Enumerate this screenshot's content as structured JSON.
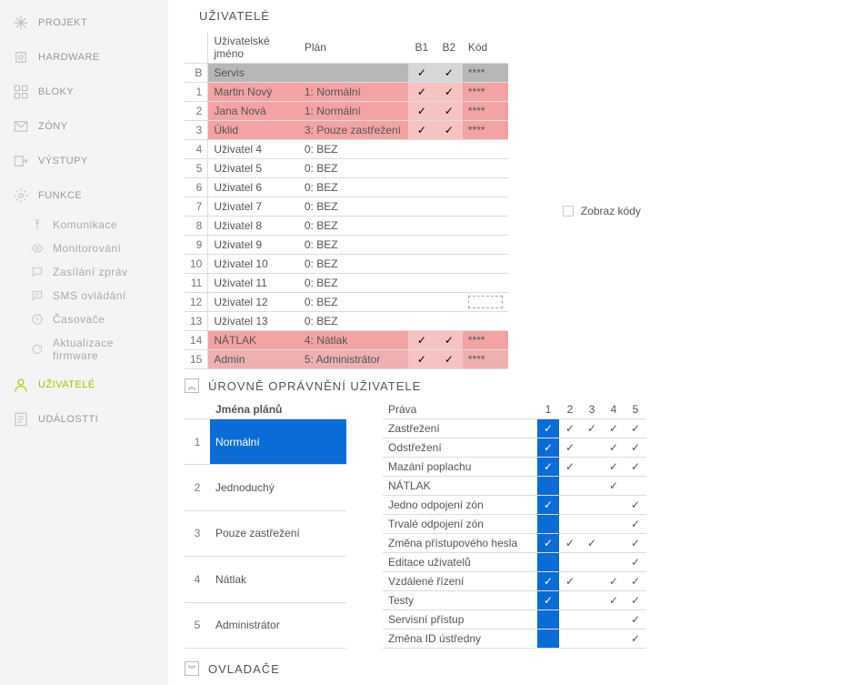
{
  "sidebar": {
    "projekt": "PROJEKT",
    "hardware": "HARDWARE",
    "bloky": "BLOKY",
    "zony": "ZÓNY",
    "vystupy": "VÝSTUPY",
    "funkce": "FUNKCE",
    "komunikace": "Komunikace",
    "monitorovani": "Monitorování",
    "zasilani": "Zasílání zpráv",
    "sms": "SMS ovládání",
    "casovace": "Časovače",
    "aktualizace": "Aktualizace firmware",
    "uzivatele": "UŽIVATELÉ",
    "udalosti": "UDÁLOSTTI"
  },
  "headings": {
    "users": "UŽIVATELÉ",
    "levels": "ÚROVNĚ OPRÁVNĚNÍ UŽIVATELE",
    "controllers": "OVLADAČE"
  },
  "showcodes_label": "Zobraz kódy",
  "users_table": {
    "h_num": "",
    "h_name": "Uživatelské jméno",
    "h_plan": "Plán",
    "h_b1": "B1",
    "h_b2": "B2",
    "h_kod": "Kód",
    "rows": [
      {
        "n": "B",
        "name": "Servis",
        "plan": "",
        "b1": "✓",
        "b2": "✓",
        "kod": "****",
        "cls": "greyrow"
      },
      {
        "n": "1",
        "name": "Martin Nový",
        "plan": "1: Normální",
        "b1": "✓",
        "b2": "✓",
        "kod": "****",
        "cls": "pinkrow"
      },
      {
        "n": "2",
        "name": "Jana Nová",
        "plan": "1: Normální",
        "b1": "✓",
        "b2": "✓",
        "kod": "****",
        "cls": "pinkrow"
      },
      {
        "n": "3",
        "name": "Úklid",
        "plan": "3: Pouze zastřežení",
        "b1": "✓",
        "b2": "✓",
        "kod": "****",
        "cls": "pinkrow"
      },
      {
        "n": "4",
        "name": "Uživatel  4",
        "plan": "0: BEZ",
        "b1": "",
        "b2": "",
        "kod": "",
        "cls": ""
      },
      {
        "n": "5",
        "name": "Uživatel  5",
        "plan": "0: BEZ",
        "b1": "",
        "b2": "",
        "kod": "",
        "cls": ""
      },
      {
        "n": "6",
        "name": "Uživatel  6",
        "plan": "0: BEZ",
        "b1": "",
        "b2": "",
        "kod": "",
        "cls": ""
      },
      {
        "n": "7",
        "name": "Uživatel  7",
        "plan": "0: BEZ",
        "b1": "",
        "b2": "",
        "kod": "",
        "cls": ""
      },
      {
        "n": "8",
        "name": "Uživatel  8",
        "plan": "0: BEZ",
        "b1": "",
        "b2": "",
        "kod": "",
        "cls": ""
      },
      {
        "n": "9",
        "name": "Uživatel  9",
        "plan": "0: BEZ",
        "b1": "",
        "b2": "",
        "kod": "",
        "cls": ""
      },
      {
        "n": "10",
        "name": "Uživatel 10",
        "plan": "0: BEZ",
        "b1": "",
        "b2": "",
        "kod": "",
        "cls": ""
      },
      {
        "n": "11",
        "name": "Uživatel 11",
        "plan": "0: BEZ",
        "b1": "",
        "b2": "",
        "kod": "",
        "cls": ""
      },
      {
        "n": "12",
        "name": "Uživatel 12",
        "plan": "0: BEZ",
        "b1": "",
        "b2": "",
        "kod": "dash",
        "cls": ""
      },
      {
        "n": "13",
        "name": "Uživatel 13",
        "plan": "0: BEZ",
        "b1": "",
        "b2": "",
        "kod": "",
        "cls": ""
      },
      {
        "n": "14",
        "name": "NÁTLAK",
        "plan": "4: Nátlak",
        "b1": "✓",
        "b2": "✓",
        "kod": "****",
        "cls": "pinkrow"
      },
      {
        "n": "15",
        "name": "Admin",
        "plan": "5: Administrátor",
        "b1": "✓",
        "b2": "✓",
        "kod": "****",
        "cls": "pink2"
      }
    ]
  },
  "plans_table": {
    "h_name": "Jména plánů",
    "rows": [
      {
        "n": "1",
        "name": "Normální",
        "sel": true
      },
      {
        "n": "2",
        "name": "Jednoduchý",
        "sel": false
      },
      {
        "n": "3",
        "name": "Pouze zastřežení",
        "sel": false
      },
      {
        "n": "4",
        "name": "Nátlak",
        "sel": false
      },
      {
        "n": "5",
        "name": "Administrátor",
        "sel": false
      }
    ]
  },
  "rights_table": {
    "h_name": "Práva",
    "rows": [
      {
        "name": "Zastřežení",
        "c": [
          "✓",
          "✓",
          "✓",
          "✓",
          "✓"
        ]
      },
      {
        "name": "Odstřežení",
        "c": [
          "✓",
          "✓",
          "",
          "✓",
          "✓"
        ]
      },
      {
        "name": "Mazání poplachu",
        "c": [
          "✓",
          "✓",
          "",
          "✓",
          "✓"
        ]
      },
      {
        "name": "NÁTLAK",
        "c": [
          "",
          "",
          "",
          "✓",
          ""
        ]
      },
      {
        "name": "Jedno odpojení zón",
        "c": [
          "✓",
          "",
          "",
          "",
          "✓"
        ]
      },
      {
        "name": "Trvalé odpojení zón",
        "c": [
          "",
          "",
          "",
          "",
          "✓"
        ]
      },
      {
        "name": "Změna přístupového hesla",
        "c": [
          "✓",
          "✓",
          "✓",
          "",
          "✓"
        ]
      },
      {
        "name": "Editace uživatelů",
        "c": [
          "",
          "",
          "",
          "",
          "✓"
        ]
      },
      {
        "name": "Vzdálené řízení",
        "c": [
          "✓",
          "✓",
          "",
          "✓",
          "✓"
        ]
      },
      {
        "name": "Testy",
        "c": [
          "✓",
          "",
          "",
          "✓",
          "✓"
        ]
      },
      {
        "name": "Servisní přístup",
        "c": [
          "",
          "",
          "",
          "",
          "✓"
        ]
      },
      {
        "name": "Změna ID ústředny",
        "c": [
          "",
          "",
          "",
          "",
          "✓"
        ]
      }
    ]
  }
}
